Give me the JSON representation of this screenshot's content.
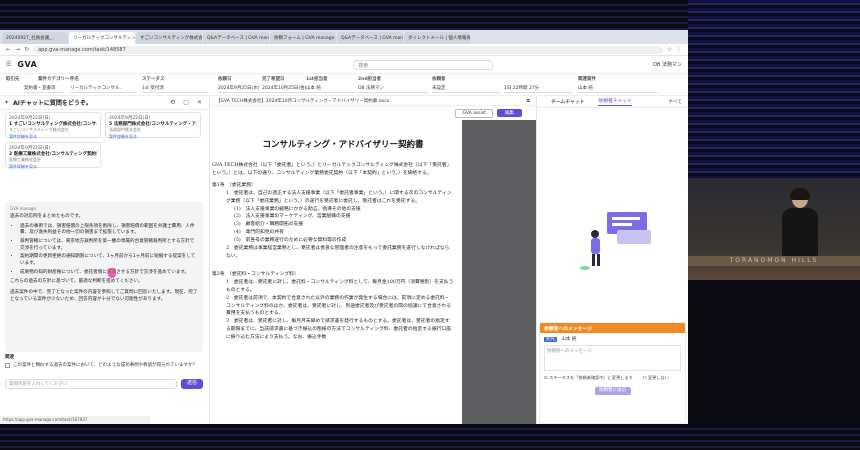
{
  "browser": {
    "tabs": [
      "20240927_社員会議_..",
      "リーガルテックコンサルティン..",
      "すごいコンサルティング株式会社..",
      "Q&Aデータベース | GVA manage",
      "依頼フォーム | GVA manage",
      "Q&Aデータベース | GVA manage",
      "ダイレクトメール | 個人情報保護.."
    ],
    "url": "app.gva-manage.com/task/148587"
  },
  "app": {
    "logo": "GVA",
    "search_placeholder": "検索",
    "user": "OB 法務マン"
  },
  "filters": {
    "labels": [
      "取引先",
      "案件カテゴリー",
      "件名",
      "ステータス",
      "依頼日",
      "完了希望日",
      "1st担当者",
      "2nd担当者",
      "依頼者",
      "関連案件"
    ],
    "values": [
      "契約書・覚書等",
      "リーガルテックコンサル..",
      "1st 受付済",
      "2024年9月25日(水)",
      "2024年10月25日(金)",
      "山本 純",
      "OB 法務マン",
      "未設定",
      "1日 22時間 27分",
      "山本 純"
    ]
  },
  "ai_panel": {
    "title": "AIチャットに質問をどうぞ。",
    "cards": [
      {
        "date": "2024年9月22日(日)",
        "title": "1 すごいコンサルティング株式会社/コンサ..",
        "sub": "すごいコンサルティング株式会社",
        "link": "案件詳細を見る"
      },
      {
        "date": "2024年9月22日(日)",
        "title": "5 法務部門株式会社/コンサルティング・ア..",
        "sub": "法務部門株式会社",
        "link": "案件詳細を見る"
      },
      {
        "date": "2024年9月22日(日)",
        "title": "2 医療工業株式会社/コンサルティング契約書",
        "sub": "医療工業株式会社",
        "link": "案件詳細を見る"
      }
    ],
    "answer_from": "GVA manage",
    "answer_intro": "過去の対応例をまとめたものです。",
    "answer_items": [
      "過去の事例では、損害賠償の上限条項を削除し、損害賠償の範囲を弁護士費用、人件費、及び逸失利益その他一切の損害まで拡張しています。",
      "裁判管轄については、東京地方裁判所を第一審の専属的合意管轄裁判所とする方針で交渉を行っています。",
      "契約期間の更新拒絶の通知期限について、1ヶ月前から1ヶ月前に短縮する提案をしています。",
      "成果物の知的財産権について、委託者側に帰属させる方針で交渉を進めています。"
    ],
    "answer_outro": "これらの過去の方針に基づいて、最適な判断を進めてください。",
    "answer_note": "過去案件の中で、完了となった案件の内容を参照してご質問に回答いたします。現在、完了となっている案件が少ないため、回答内容が十分でない可能性があります。",
    "related_title": "関連",
    "related_question": "この案件と類似する過去の案件において、どのような成功事例や教訓が得られていますか？",
    "input_placeholder": "質問内容を入力してください",
    "send_label": "送信",
    "status_url": "https://app.gva-manage.com/task/167837"
  },
  "document": {
    "filename": "【GVA TECH株式会社】2024年10月コンサルティング・アドバイザリー契約書.docx",
    "btn_outline": "GVA assist",
    "btn_primary": "編集",
    "title": "コンサルティング・アドバイザリー契約書",
    "intro": "GVA TECH株式会社（以下「委託者」という。）とリーガルテックコンサルティング株式会社（以下「受託者」という。）とは、以下の通り、コンサルティング業務委託契約（以下「本契約」という。）を締結する。",
    "art1": "第1条　（委託業務）",
    "art1_1": "1　委託者は、自己の適正する法人支援事業（以下「委託者事業」という。）に関する次のコンサルティング業務（以下「委託業務」という。）の遂行を受託者に委託し、受託者はこれを受託する。",
    "art1_items": [
      "(1)　法人支援事業の戦略にかかる助言、指導その他の支援",
      "(2)　法人支援事業のマーケティング、営業組織の支援",
      "(3)　顧客紹介・職務開拓の支援",
      "(4)　専門的知見の共有",
      "(5)　前各号の業務遂行のために必要な資料等の作成"
    ],
    "art1_2": "2　委託業務は事業経営業務とし、受託者は善良な管理者の注意をもって委託業務を遂行しなければならない。",
    "art2": "第2条　（委託料・コンサルティング料）",
    "art2_1": "1　委託者は、受託者に対し、委託料・コンサルティング料として、毎月金100万円（消費税別）を支払うものとする。",
    "art2_2": "2　委託者は前項で、本契約で合意された以外の業務の作業が発生する場合には、前項に定める委託料・コンサルティング料のほか、委託者は、受託者に対し、別途委託者及び受託者の間の協議にて合意される費用を支払うものとする。",
    "art2_3": "3　委託者は、受託者に対し、毎月月末締めで請求書を発行するものとする。委託者は、受託者の指定する期限までに、当該請求書に基づき振込の態様の方法でコンサルティング料、委託者の指定する銀行口座に振り込む方法により支払う。なお、振込手数"
  },
  "right_panel": {
    "tabs": [
      "チームチャット",
      "依頼者チャット",
      "すべて"
    ],
    "msg_header": "依頼者へのメッセージ",
    "msg_to_tag": "宛先",
    "msg_to": "山本 純",
    "msg_placeholder": "依頼者へのメッセージ",
    "opt1": "ステータスを「依頼者確認中」に変更します",
    "opt2": "変更しない",
    "send_label": "依頼者に送信"
  },
  "video": {
    "banner": "TORANOMON HILLS"
  },
  "colors": {
    "accent": "#5b4fd6",
    "orange": "#f08a24",
    "link": "#2a5bd7"
  }
}
